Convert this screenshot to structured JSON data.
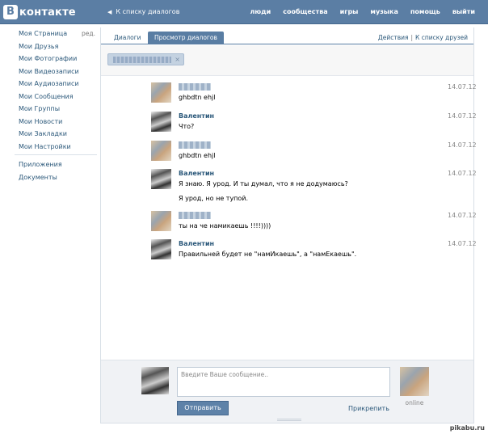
{
  "header": {
    "logo_mark": "В",
    "logo_text": "контакте",
    "back_label": "К списку диалогов",
    "nav": [
      "люди",
      "сообщества",
      "игры",
      "музыка",
      "помощь",
      "выйти"
    ]
  },
  "sidebar": {
    "edit_label": "ред.",
    "items": [
      "Моя Страница",
      "Мои Друзья",
      "Мои Фотографии",
      "Мои Видеозаписи",
      "Мои Аудиозаписи",
      "Мои Сообщения",
      "Мои Группы",
      "Мои Новости",
      "Мои Закладки",
      "Мои Настройки"
    ],
    "extra": [
      "Приложения",
      "Документы"
    ]
  },
  "tabs": {
    "dialogs": "Диалоги",
    "view": "Просмотр диалогов",
    "actions": "Действия",
    "separator": "|",
    "to_friends": "К списку друзей"
  },
  "recipient": {
    "remove": "×"
  },
  "messages": [
    {
      "author": "",
      "lines": [
        "ghbdtn ehjl"
      ],
      "date": "14.07.12"
    },
    {
      "author": "Валентин",
      "lines": [
        "Что?"
      ],
      "date": "14.07.12"
    },
    {
      "author": "",
      "lines": [
        "ghbdtn ehjl"
      ],
      "date": "14.07.12"
    },
    {
      "author": "Валентин",
      "lines": [
        "Я знаю. Я урод. И ты думал, что я не додумаюсь?",
        "Я урод, но не тупой."
      ],
      "date": "14.07.12"
    },
    {
      "author": "",
      "lines": [
        "ты на че намикаешь !!!!))))"
      ],
      "date": "14.07.12"
    },
    {
      "author": "Валентин",
      "lines": [
        "Правильней будет не \"намИкаешь\", а \"намЕкаешь\"."
      ],
      "date": "14.07.12"
    }
  ],
  "compose": {
    "placeholder": "Введите Ваше сообщение..",
    "send_label": "Отправить",
    "attach_label": "Прикрепить",
    "peer_status": "online"
  },
  "watermark": "pikabu.ru"
}
